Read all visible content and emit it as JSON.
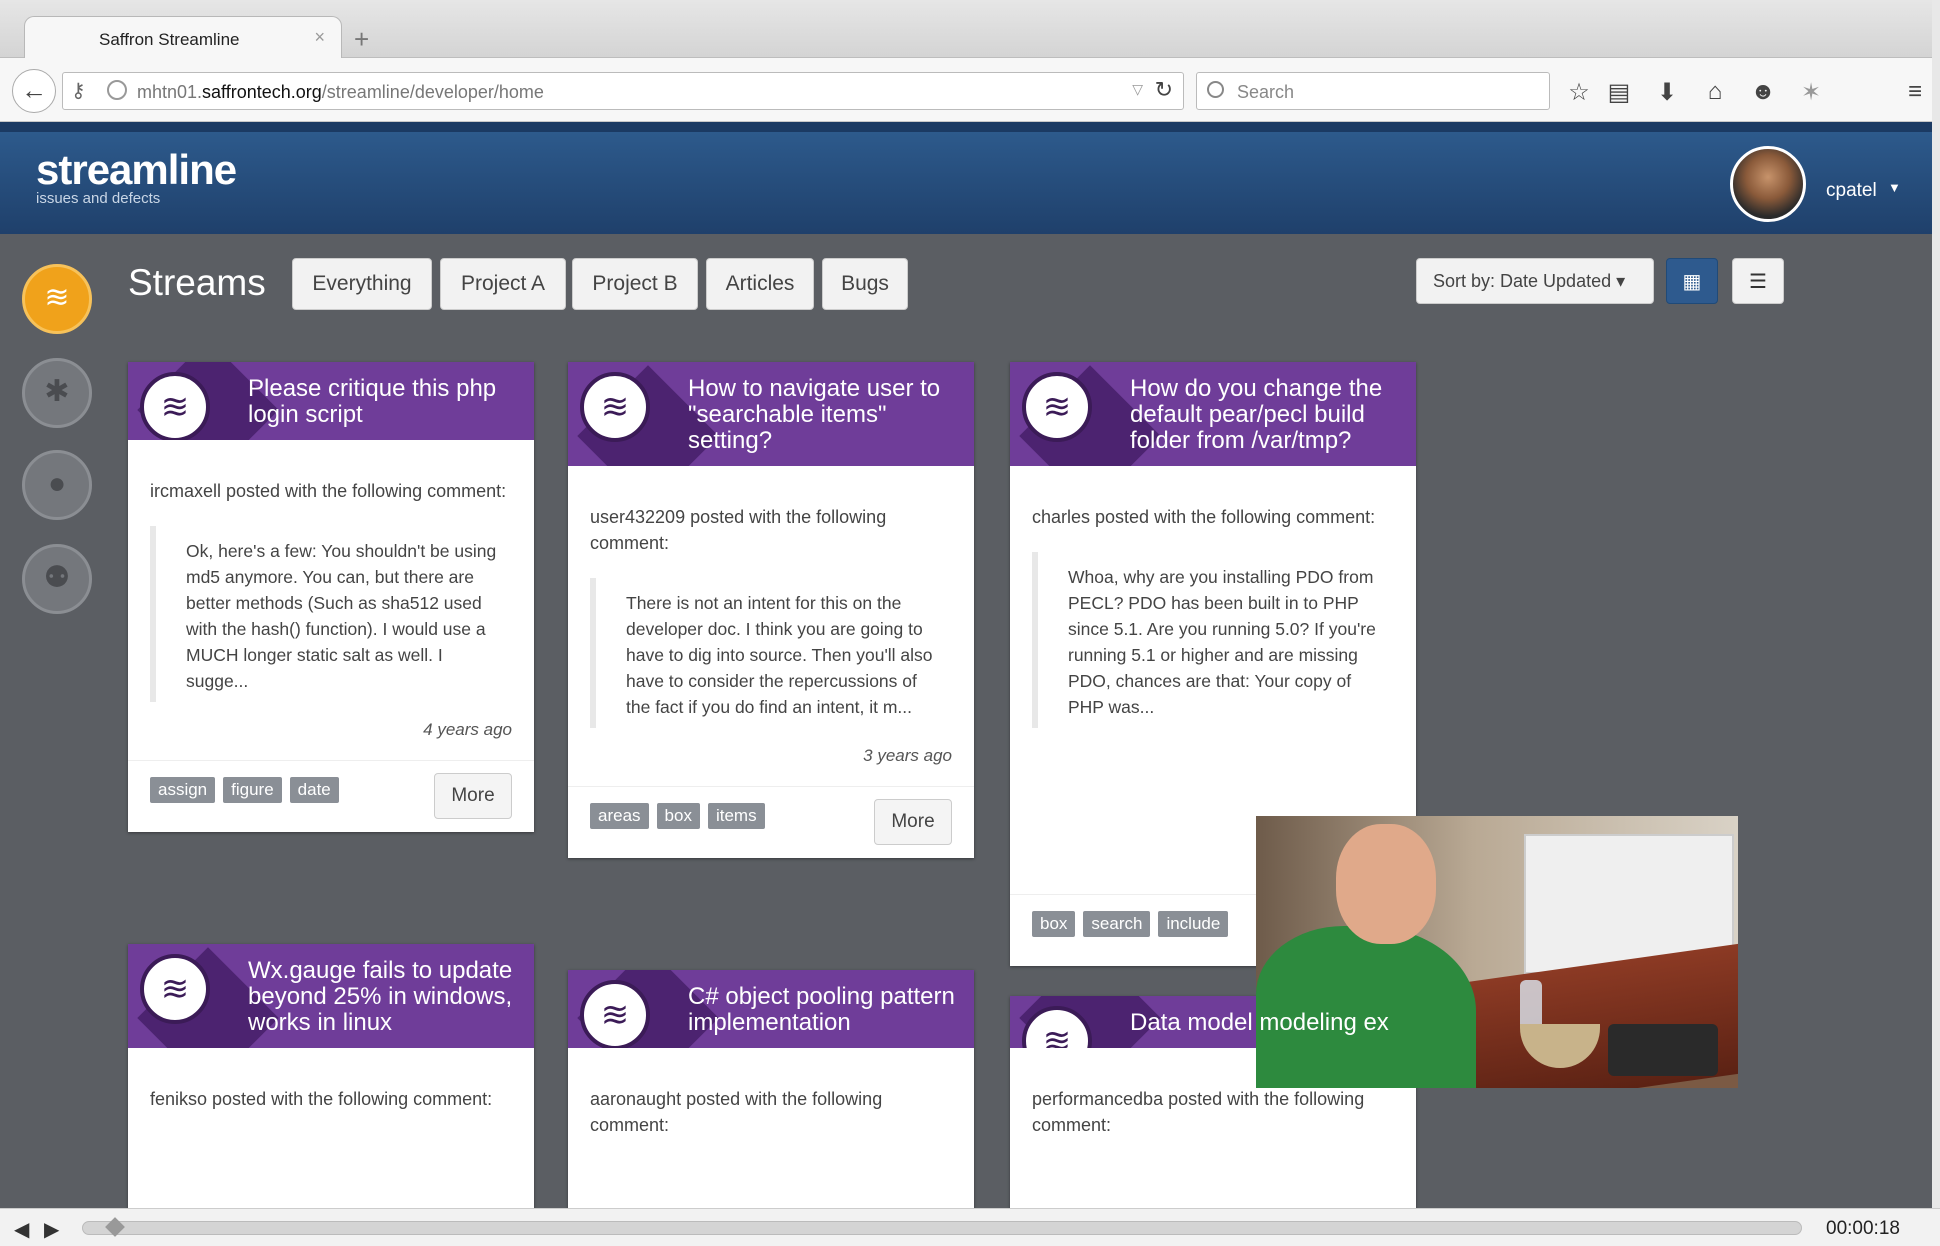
{
  "browser": {
    "tab_title": "Saffron Streamline",
    "tab_close": "×",
    "new_tab": "+",
    "url_prefix": "mhtn01.",
    "url_domain": "saffrontech.org",
    "url_path": "/streamline/developer/home",
    "search_placeholder": "Search"
  },
  "app": {
    "logo": "streamline",
    "logo_sub": "issues and defects",
    "username": "cpatel"
  },
  "sidebar": {
    "items": [
      {
        "icon": "streams-icon",
        "glyph": "≋",
        "active": true
      },
      {
        "icon": "bug-icon",
        "glyph": "✱",
        "active": false
      },
      {
        "icon": "lightbulb-icon",
        "glyph": "●",
        "active": false
      },
      {
        "icon": "people-icon",
        "glyph": "⚉",
        "active": false
      }
    ]
  },
  "toolbar": {
    "title": "Streams",
    "filters": [
      "Everything",
      "Project A",
      "Project B",
      "Articles",
      "Bugs"
    ],
    "sort_label": "Sort by: Date Updated ▾"
  },
  "cards": [
    {
      "title": "Please critique this php login script",
      "author": "ircmaxell posted with the following comment:",
      "quote": "Ok, here's a few: You shouldn't be using md5 anymore. You can, but there are better methods (Such as sha512 used with the hash() function). I would use a MUCH longer static salt as well. I sugge...",
      "time": "4 years ago",
      "tags": [
        "assign",
        "figure",
        "date"
      ],
      "more": "More"
    },
    {
      "title": "How to navigate user to \"searchable items\" setting?",
      "author": "user432209 posted with the following comment:",
      "quote": "There is not an intent for this on the developer doc. I think you are going to have to dig into source. Then you'll also have to consider the repercussions of the fact if you do find an intent, it m...",
      "time": "3 years ago",
      "tags": [
        "areas",
        "box",
        "items"
      ],
      "more": "More"
    },
    {
      "title": "How do you change the default pear/pecl build folder from /var/tmp?",
      "author": "charles posted with the following comment:",
      "quote": "Whoa, why are you installing PDO from PECL? PDO has been built in to PHP since 5.1. Are you running 5.0? If you're running 5.1 or higher and are missing PDO, chances are that: Your copy of PHP was...",
      "tags": [
        "box",
        "search",
        "include"
      ]
    },
    {
      "title": "Wx.gauge fails to update beyond 25% in windows, works in linux",
      "author": "fenikso posted with the following comment:"
    },
    {
      "title": "C# object pooling pattern implementation",
      "author": "aaronaught posted with the following comment:"
    },
    {
      "title": "Data model modeling ex",
      "author": "performancedba posted with the following comment:"
    }
  ],
  "player": {
    "timecode": "00:00:18",
    "progress": 0.01
  }
}
